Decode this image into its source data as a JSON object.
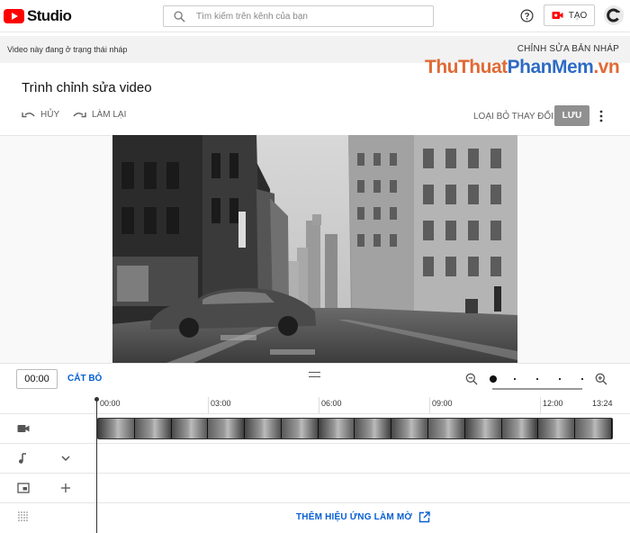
{
  "header": {
    "logo_text": "Studio",
    "search_placeholder": "Tìm kiếm trên kênh của bạn",
    "create_label": "TẠO",
    "brand_color": "#ff0000"
  },
  "draft_bar": {
    "status_text": "Video này đang ở trạng thái nháp",
    "edit_draft_label": "CHỈNH SỬA BẢN NHÁP"
  },
  "watermark": {
    "part1": "ThuThuat",
    "part2": "PhanMem",
    "part3": ".vn"
  },
  "editor": {
    "title": "Trình chỉnh sửa video",
    "undo_label": "HỦY",
    "redo_label": "LÀM LẠI",
    "discard_label": "LOẠI BỎ THAY ĐỔI",
    "save_label": "LƯU"
  },
  "controls": {
    "current_time": "00:00",
    "trim_label": "CẮT BỎ",
    "zoom_level": 0
  },
  "timeline": {
    "ruler": [
      "00:00",
      "03:00",
      "06:00",
      "09:00",
      "12:00",
      "13:24"
    ],
    "tracks": [
      {
        "name": "video",
        "icon": "video-camera-icon"
      },
      {
        "name": "audio",
        "icon": "music-note-icon"
      },
      {
        "name": "end-screen",
        "icon": "end-screen-icon"
      },
      {
        "name": "blur",
        "icon": "blur-grid-icon"
      }
    ],
    "add_blur_label": "THÊM HIỆU ỨNG LÀM MỜ",
    "accent_color": "#065fd4"
  }
}
